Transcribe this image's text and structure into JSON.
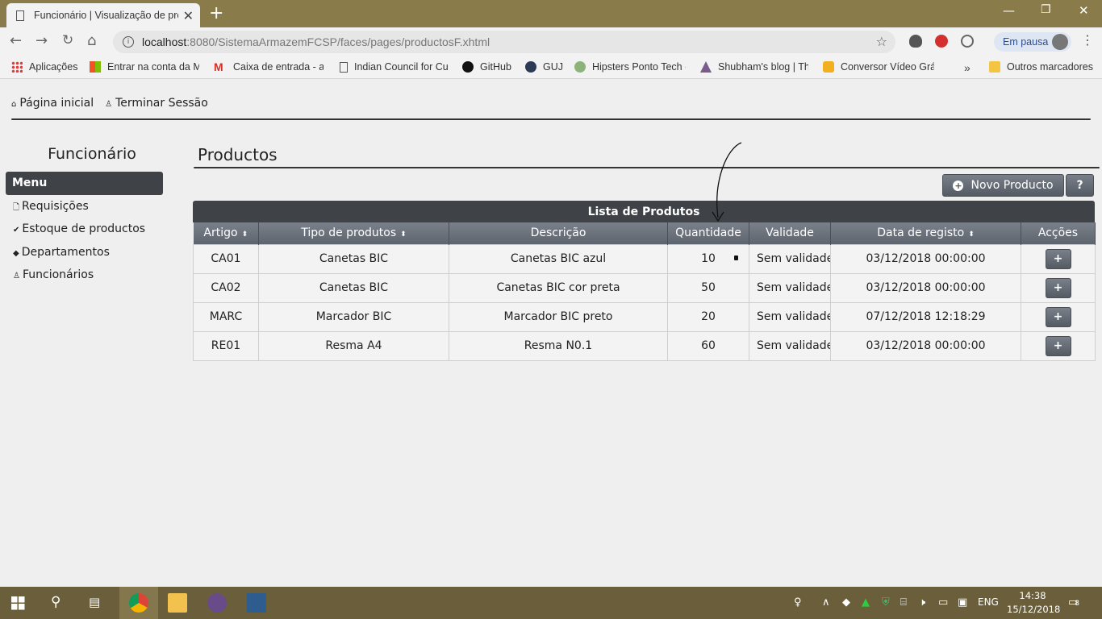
{
  "browser": {
    "tab_title": "Funcionário | Visualização de pro",
    "url_host": "localhost",
    "url_rest": ":8080/SistemaArmazemFCSP/faces/pages/productosF.xhtml",
    "profile_status": "Em pausa",
    "bookmarks": [
      {
        "label": "Aplicações",
        "icon": "apps-grid-icon"
      },
      {
        "label": "Entrar na conta da M",
        "icon": "microsoft-icon"
      },
      {
        "label": "Caixa de entrada - ay",
        "icon": "gmail-icon"
      },
      {
        "label": "Indian Council for Cu",
        "icon": "page-icon"
      },
      {
        "label": "GitHub",
        "icon": "github-icon"
      },
      {
        "label": "GUJ",
        "icon": "guj-icon"
      },
      {
        "label": "Hipsters Ponto Tech -",
        "icon": "hipsters-icon"
      },
      {
        "label": "Shubham's blog | Thi",
        "icon": "blog-icon"
      },
      {
        "label": "Conversor Vídeo Grát",
        "icon": "video-icon"
      }
    ],
    "other_bookmarks": "Outros marcadores"
  },
  "topnav": {
    "home": "Página inicial",
    "logout": "Terminar Sessão"
  },
  "sidebar": {
    "title": "Funcionário",
    "menu_header": "Menu",
    "items": [
      {
        "label": "Requisições",
        "icon": "document-icon"
      },
      {
        "label": "Estoque de productos",
        "icon": "check-icon"
      },
      {
        "label": "Departamentos",
        "icon": "tag-icon"
      },
      {
        "label": "Funcionários",
        "icon": "user-icon"
      }
    ]
  },
  "main": {
    "title": "Productos",
    "new_button": "Novo Producto",
    "help_button": "?",
    "grid_title": "Lista de Produtos",
    "columns": [
      "Artigo",
      "Tipo de produtos",
      "Descrição",
      "Quantidade",
      "Validade",
      "Data de registo",
      "Acções"
    ],
    "rows": [
      {
        "artigo": "CA01",
        "tipo": "Canetas BIC",
        "descricao": "Canetas BIC azul",
        "quantidade": "10",
        "validade": "Sem validade",
        "data": "03/12/2018 00:00:00",
        "accao": "+"
      },
      {
        "artigo": "CA02",
        "tipo": "Canetas BIC",
        "descricao": "Canetas BIC cor preta",
        "quantidade": "50",
        "validade": "Sem validade",
        "data": "03/12/2018 00:00:00",
        "accao": "+"
      },
      {
        "artigo": "MARC",
        "tipo": "Marcador BIC",
        "descricao": "Marcador BIC preto",
        "quantidade": "20",
        "validade": "Sem validade",
        "data": "07/12/2018 12:18:29",
        "accao": "+"
      },
      {
        "artigo": "RE01",
        "tipo": "Resma A4",
        "descricao": "Resma N0.1",
        "quantidade": "60",
        "validade": "Sem validade",
        "data": "03/12/2018 00:00:00",
        "accao": "+"
      }
    ]
  },
  "taskbar": {
    "language": "ENG",
    "time": "14:38",
    "date": "15/12/2018",
    "notifications": "8"
  }
}
